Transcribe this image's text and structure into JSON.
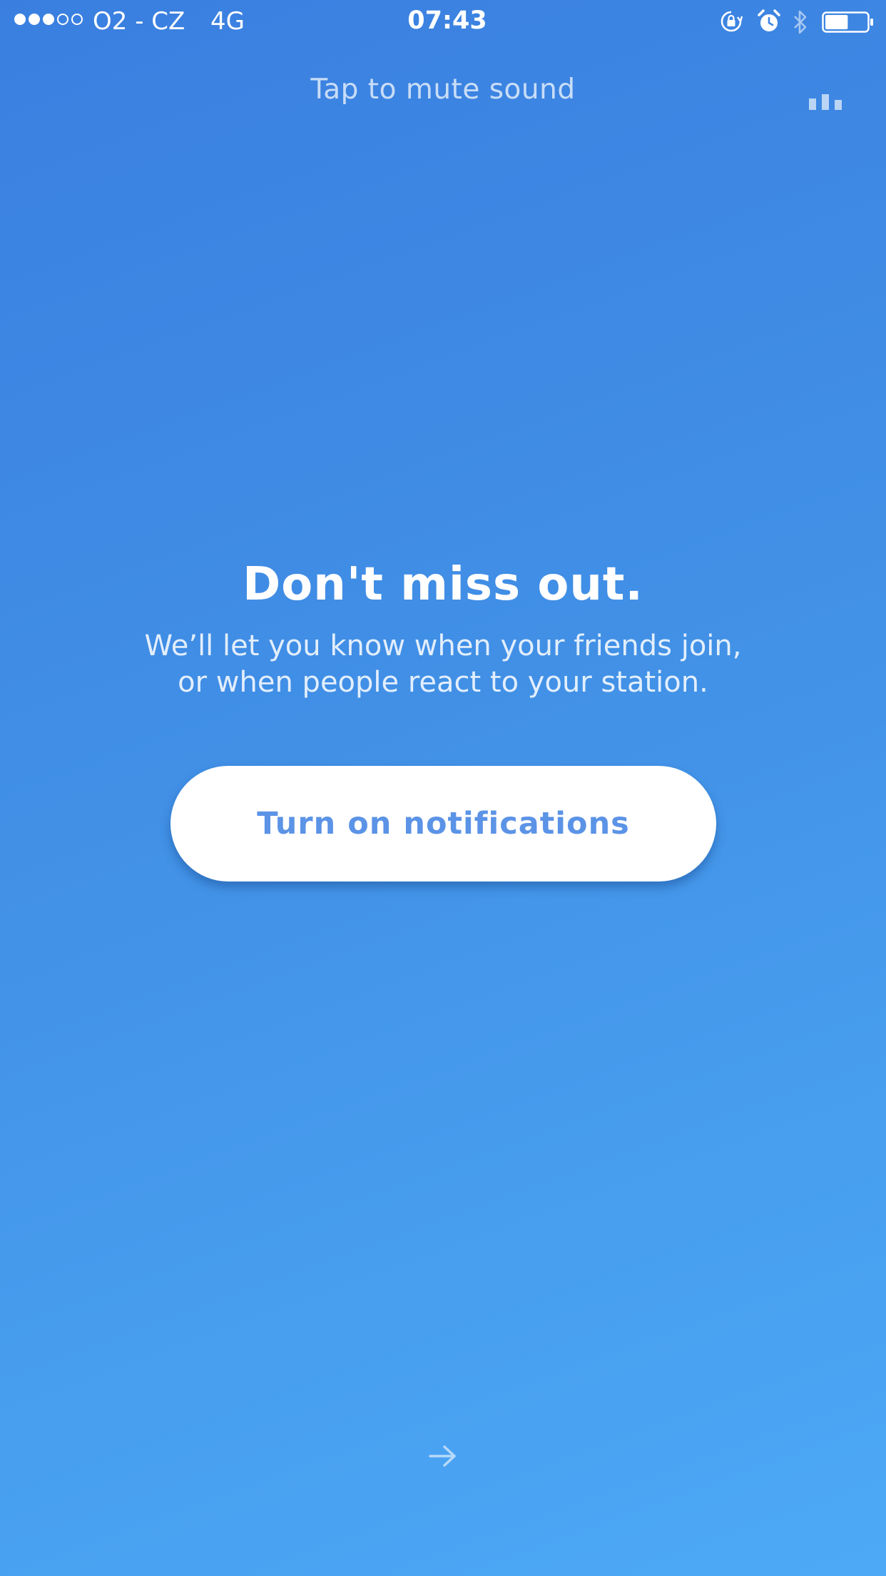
{
  "status_bar": {
    "signal_strength": "3 of 5",
    "carrier": "O2 - CZ",
    "network": "4G",
    "time": "07:43",
    "icons": [
      "rotation-lock-icon",
      "alarm-icon",
      "bluetooth-icon",
      "battery-icon"
    ],
    "battery_level": 0.55
  },
  "top_bar": {
    "mute_label": "Tap to mute sound",
    "sound_icon": "sound-bars-icon"
  },
  "main": {
    "headline": "Don't miss out.",
    "subtext_line1": "We’ll let you know when your friends join,",
    "subtext_line2": "or when people react to your station.",
    "button_label": "Turn on notifications"
  },
  "footer": {
    "next_icon": "right-arrow-icon"
  },
  "colors": {
    "background_start": "#3a7fe0",
    "background_end": "#4da9f6",
    "button_background": "#ffffff",
    "button_text": "#5b93e6"
  }
}
